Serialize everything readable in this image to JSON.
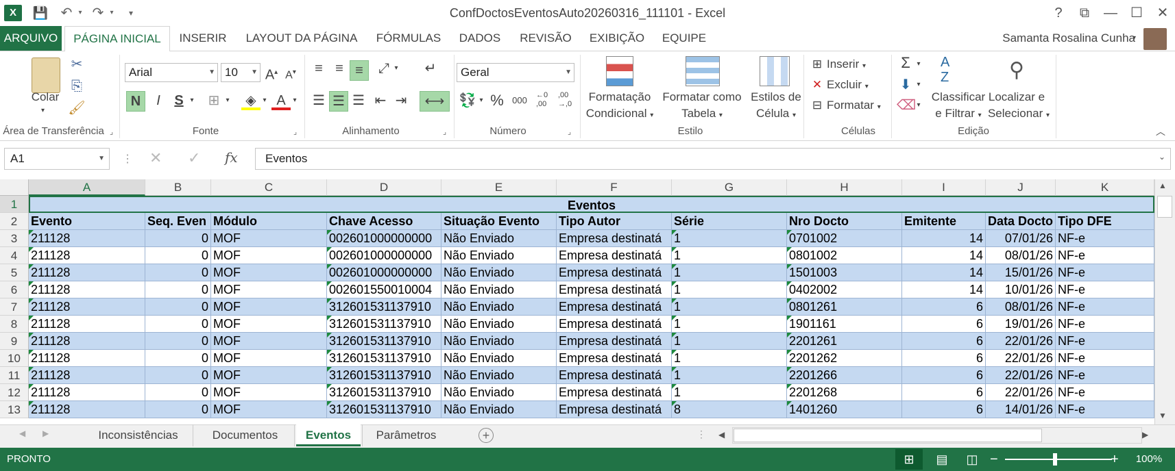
{
  "window": {
    "title": "ConfDoctosEventosAuto20260316_111101 - Excel",
    "help": "?",
    "ribbon_display": "⧉",
    "minimize": "—",
    "maximize": "☐",
    "close": "✕"
  },
  "qat": {
    "undo": "↶",
    "redo": "↷",
    "customize": "▾"
  },
  "tabs": [
    "ARQUIVO",
    "PÁGINA INICIAL",
    "INSERIR",
    "LAYOUT DA PÁGINA",
    "FÓRMULAS",
    "DADOS",
    "REVISÃO",
    "EXIBIÇÃO",
    "EQUIPE"
  ],
  "user": {
    "name": "Samanta Rosalina Cunha"
  },
  "ribbon": {
    "clipboard": {
      "label": "Área de Transferência",
      "paste": "Colar"
    },
    "font": {
      "label": "Fonte",
      "name": "Arial",
      "size": "10",
      "bold": "N",
      "italic": "I",
      "underline": "S"
    },
    "alignment": {
      "label": "Alinhamento"
    },
    "number": {
      "label": "Número",
      "format": "Geral",
      "percent": "%",
      "thousands": "000",
      "inc_decimal": "←0\n,00",
      "dec_decimal": ",00\n→,0"
    },
    "styles": {
      "label": "Estilo",
      "cond_format_1": "Formatação",
      "cond_format_2": "Condicional",
      "format_table_1": "Formatar como",
      "format_table_2": "Tabela",
      "cell_styles_1": "Estilos de",
      "cell_styles_2": "Célula"
    },
    "cells": {
      "label": "Células",
      "insert": "Inserir",
      "delete": "Excluir",
      "format": "Formatar"
    },
    "editing": {
      "label": "Edição",
      "sort_1": "Classificar",
      "sort_2": "e Filtrar",
      "find_1": "Localizar e",
      "find_2": "Selecionar"
    }
  },
  "formula_bar": {
    "name_box": "A1",
    "fx": "fx",
    "value": "Eventos"
  },
  "columns": [
    "A",
    "B",
    "C",
    "D",
    "E",
    "F",
    "G",
    "H",
    "I",
    "J",
    "K"
  ],
  "sheet": {
    "title": "Eventos",
    "headers": [
      "Evento",
      "Seq. Even",
      "Módulo",
      "Chave Acesso",
      "Situação Evento",
      "Tipo Autor",
      "Série",
      "Nro Docto",
      "Emitente",
      "Data Docto",
      "Tipo DFE"
    ],
    "rows": [
      [
        "211128",
        "0",
        "MOF",
        "002601000000000",
        "Não Enviado",
        "Empresa destinatá",
        "1",
        "0701002",
        "14",
        "07/01/26",
        "NF-e"
      ],
      [
        "211128",
        "0",
        "MOF",
        "002601000000000",
        "Não Enviado",
        "Empresa destinatá",
        "1",
        "0801002",
        "14",
        "08/01/26",
        "NF-e"
      ],
      [
        "211128",
        "0",
        "MOF",
        "002601000000000",
        "Não Enviado",
        "Empresa destinatá",
        "1",
        "1501003",
        "14",
        "15/01/26",
        "NF-e"
      ],
      [
        "211128",
        "0",
        "MOF",
        "002601550010004",
        "Não Enviado",
        "Empresa destinatá",
        "1",
        "0402002",
        "14",
        "10/01/26",
        "NF-e"
      ],
      [
        "211128",
        "0",
        "MOF",
        "312601531137910",
        "Não Enviado",
        "Empresa destinatá",
        "1",
        "0801261",
        "6",
        "08/01/26",
        "NF-e"
      ],
      [
        "211128",
        "0",
        "MOF",
        "312601531137910",
        "Não Enviado",
        "Empresa destinatá",
        "1",
        "1901161",
        "6",
        "19/01/26",
        "NF-e"
      ],
      [
        "211128",
        "0",
        "MOF",
        "312601531137910",
        "Não Enviado",
        "Empresa destinatá",
        "1",
        "2201261",
        "6",
        "22/01/26",
        "NF-e"
      ],
      [
        "211128",
        "0",
        "MOF",
        "312601531137910",
        "Não Enviado",
        "Empresa destinatá",
        "1",
        "2201262",
        "6",
        "22/01/26",
        "NF-e"
      ],
      [
        "211128",
        "0",
        "MOF",
        "312601531137910",
        "Não Enviado",
        "Empresa destinatá",
        "1",
        "2201266",
        "6",
        "22/01/26",
        "NF-e"
      ],
      [
        "211128",
        "0",
        "MOF",
        "312601531137910",
        "Não Enviado",
        "Empresa destinatá",
        "1",
        "2201268",
        "6",
        "22/01/26",
        "NF-e"
      ],
      [
        "211128",
        "0",
        "MOF",
        "312601531137910",
        "Não Enviado",
        "Empresa destinatá",
        "8",
        "1401260",
        "6",
        "14/01/26",
        "NF-e"
      ]
    ]
  },
  "sheet_tabs": [
    "Inconsistências",
    "Documentos",
    "Eventos",
    "Parâmetros"
  ],
  "status": {
    "mode": "PRONTO",
    "zoom": "100%"
  },
  "colors": {
    "accent": "#217346",
    "band": "#c5d9f1",
    "selected_col": "#dcdcdc"
  }
}
